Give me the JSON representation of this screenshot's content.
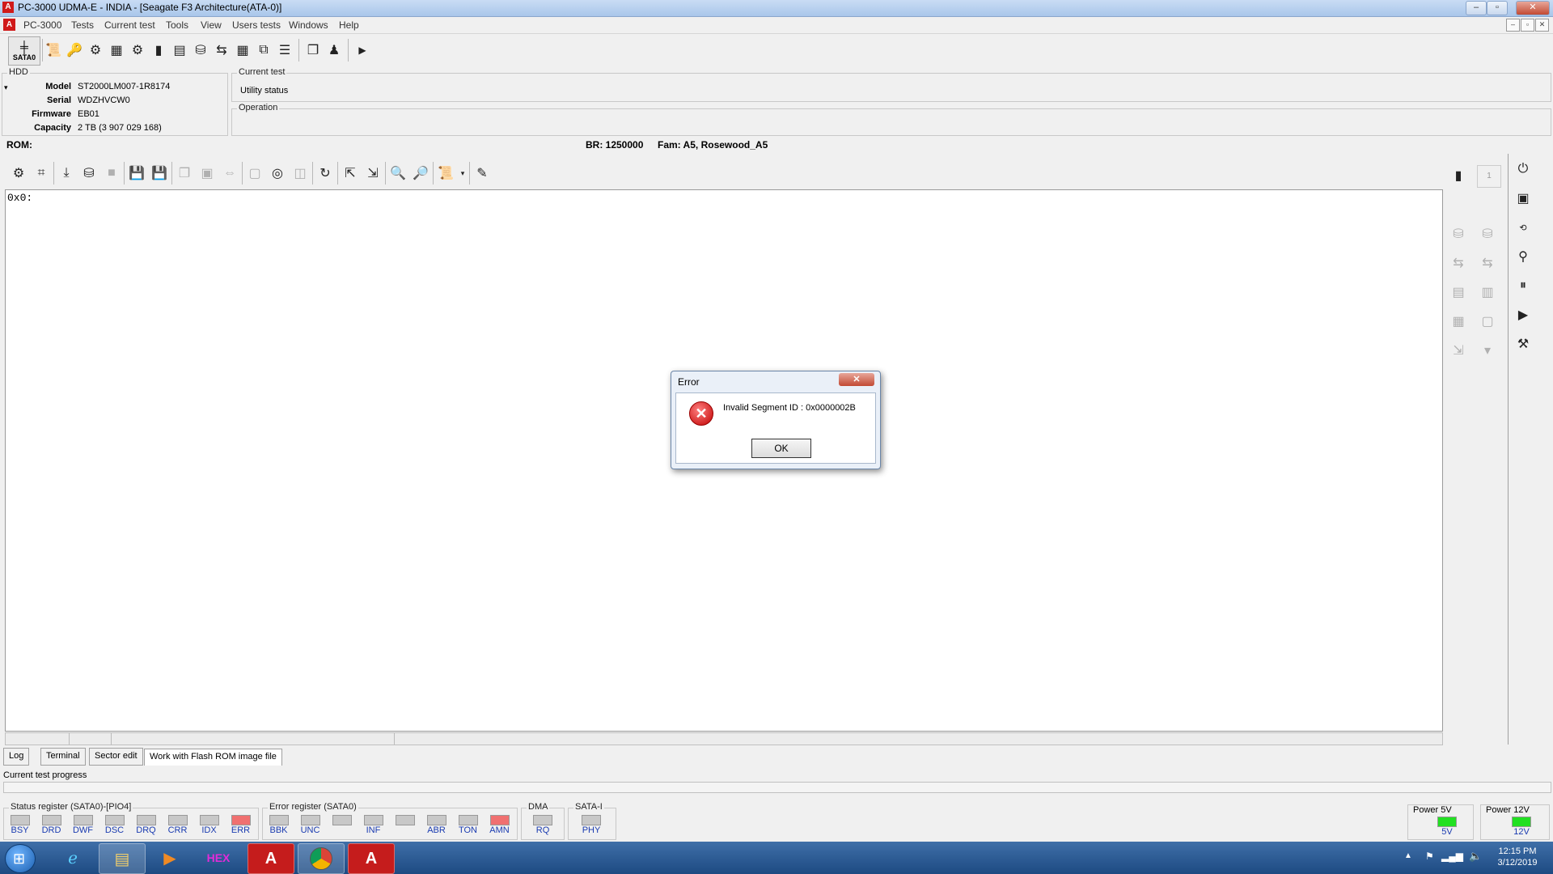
{
  "window": {
    "title": "PC-3000 UDMA-E - INDIA  - [Seagate F3 Architecture(ATA-0)]",
    "min": "–",
    "max": "▫",
    "close": "✕"
  },
  "menu": {
    "items": [
      "PC-3000",
      "Tests",
      "Current test",
      "Tools",
      "View",
      "Users tests",
      "Windows",
      "Help"
    ],
    "mdi_min": "–",
    "mdi_restore": "▫",
    "mdi_close": "✕"
  },
  "toolbar": {
    "sata_label": "SATA0",
    "run_arrow": "▶"
  },
  "hdd": {
    "group_title": "HDD",
    "model_label": "Model",
    "model": "ST2000LM007-1R8174",
    "serial_label": "Serial",
    "serial": "WDZHVCW0",
    "firmware_label": "Firmware",
    "firmware": "EB01",
    "capacity_label": "Capacity",
    "capacity": "2 TB (3 907 029 168)"
  },
  "current_test": {
    "title": "Current test",
    "value": "Utility status"
  },
  "operation": {
    "title": "Operation"
  },
  "rom_bar": {
    "rom": "ROM:",
    "br": "BR: 1250000",
    "fam": "Fam: A5, Rosewood_A5"
  },
  "editor": {
    "address": "0x0:"
  },
  "right_panel": {
    "counter": "1"
  },
  "tabs": [
    "Log",
    "Terminal",
    "Sector edit",
    "Work with Flash ROM image file"
  ],
  "progress": {
    "label": "Current test progress"
  },
  "status_register": {
    "title": "Status register (SATA0)-[PIO4]",
    "bits": [
      "BSY",
      "DRD",
      "DWF",
      "DSC",
      "DRQ",
      "CRR",
      "IDX",
      "ERR"
    ]
  },
  "error_register": {
    "title": "Error register (SATA0)",
    "bits": [
      "BBK",
      "UNC",
      "",
      "INF",
      "",
      "ABR",
      "TON",
      "AMN"
    ]
  },
  "dma": {
    "title": "DMA",
    "bit": "RQ"
  },
  "sata": {
    "title": "SATA-I",
    "bit": "PHY"
  },
  "power5": {
    "title": "Power 5V",
    "label": "5V"
  },
  "power12": {
    "title": "Power 12V",
    "label": "12V"
  },
  "dialog": {
    "title": "Error",
    "close": "✕",
    "icon": "✕",
    "message": "Invalid Segment ID : 0x0000002B",
    "ok": "OK"
  },
  "taskbar": {
    "time": "12:15 PM",
    "date": "3/12/2019",
    "hex_label": "HEX"
  },
  "colors": {
    "indicator_red": "#f07070",
    "indicator_green": "#22e022",
    "accent": "#1d4a82"
  }
}
